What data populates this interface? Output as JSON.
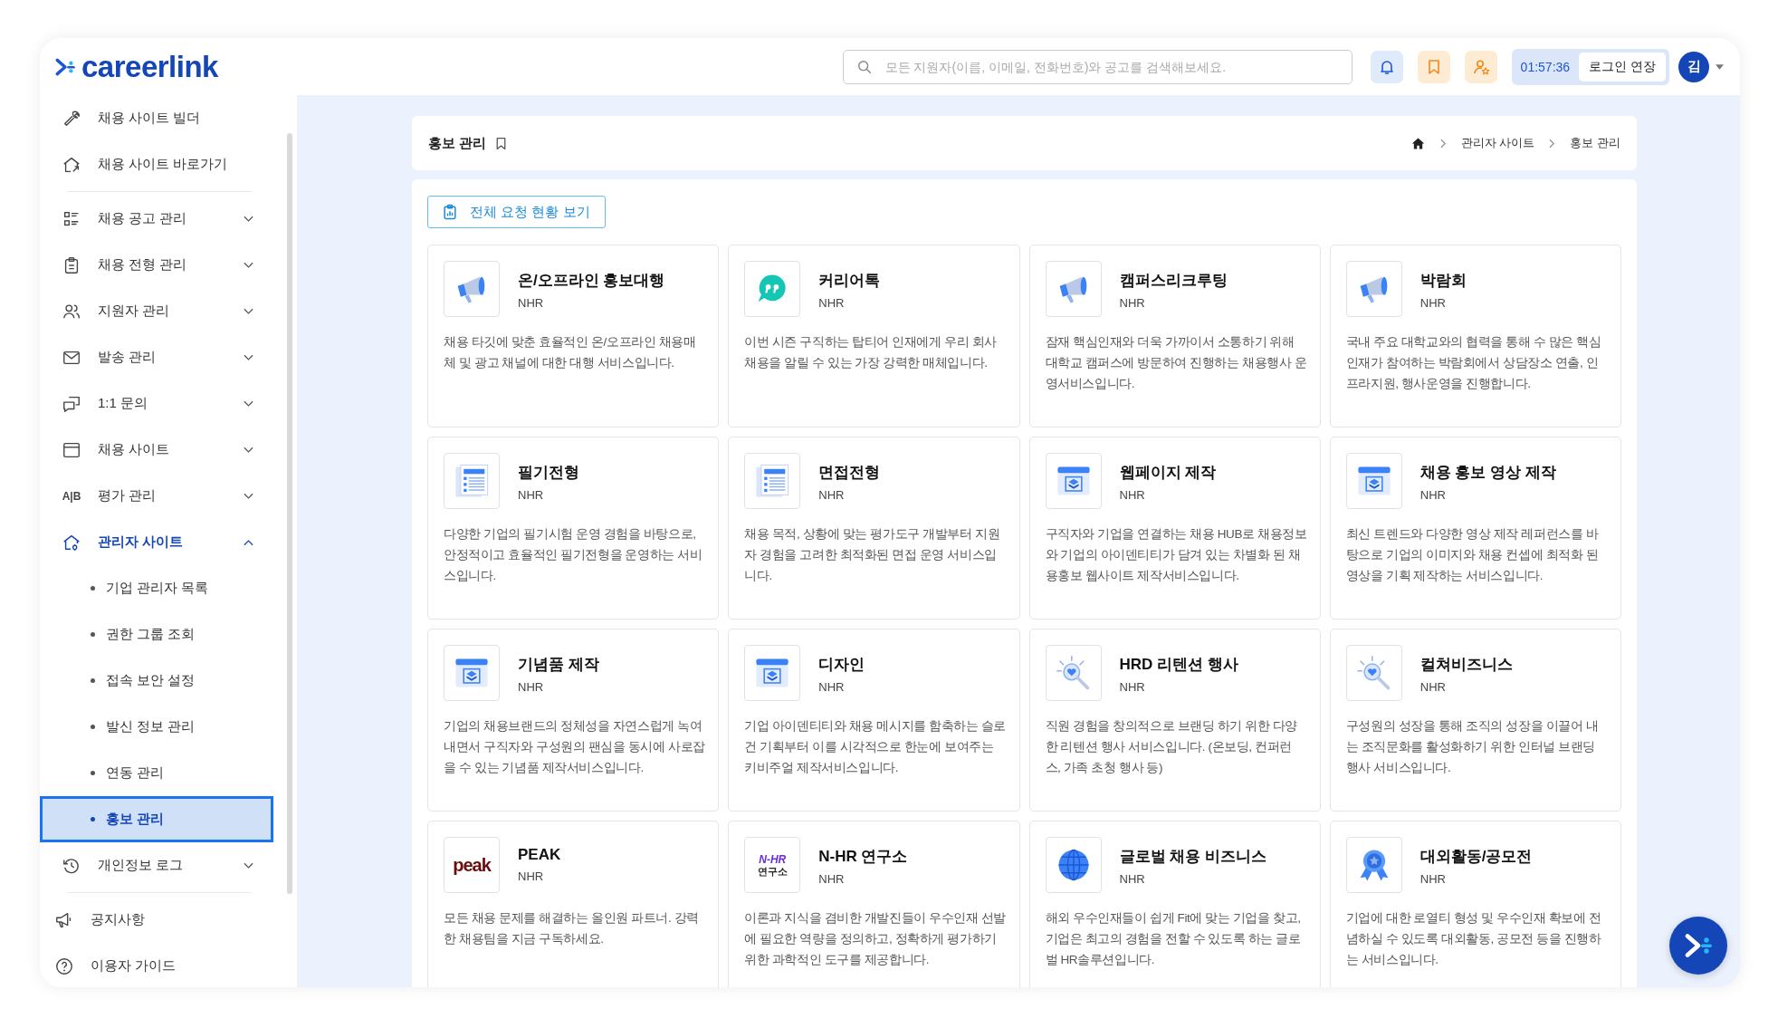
{
  "header": {
    "logo": "careerlink",
    "search": {
      "placeholder": "모든 지원자(이름, 이메일, 전화번호)와 공고를 검색해보세요."
    },
    "timer": "01:57:36",
    "extend_button": "로그인 연장",
    "avatar": "김"
  },
  "sidebar": {
    "top_links": [
      {
        "label": "채용 사이트 빌더",
        "kind": "wrench"
      },
      {
        "label": "채용 사이트 바로가기",
        "kind": "home"
      }
    ],
    "menu": [
      {
        "label": "채용 공고 관리",
        "kind": "list",
        "expanded": false
      },
      {
        "label": "채용 전형 관리",
        "kind": "clipboard",
        "expanded": false
      },
      {
        "label": "지원자 관리",
        "kind": "users",
        "expanded": false
      },
      {
        "label": "발송 관리",
        "kind": "mail",
        "expanded": false
      },
      {
        "label": "1:1 문의",
        "kind": "chat",
        "expanded": false
      },
      {
        "label": "채용 사이트",
        "kind": "window",
        "expanded": false
      },
      {
        "label": "평가 관리",
        "kind": "text",
        "icon_text": "A|B",
        "expanded": false
      },
      {
        "label": "관리자 사이트",
        "kind": "home",
        "expanded": true,
        "children": [
          {
            "label": "기업 관리자 목록",
            "selected": false
          },
          {
            "label": "권한 그룹 조회",
            "selected": false
          },
          {
            "label": "접속 보안 설정",
            "selected": false
          },
          {
            "label": "발신 정보 관리",
            "selected": false
          },
          {
            "label": "연동 관리",
            "selected": false
          },
          {
            "label": "홍보 관리",
            "selected": true
          }
        ]
      },
      {
        "label": "개인정보 로그",
        "kind": "history",
        "expanded": false
      }
    ],
    "bottom_links": [
      {
        "label": "공지사항",
        "kind": "megaphone"
      },
      {
        "label": "이용자 가이드",
        "kind": "help"
      }
    ]
  },
  "page": {
    "title": "홍보 관리",
    "breadcrumb": [
      "관리자 사이트",
      "홍보 관리"
    ],
    "view_all_button": "전체 요청 현황 보기",
    "services": [
      {
        "title": "온/오프라인 홍보대행",
        "provider": "NHR",
        "kind": "megaphone",
        "description": "채용 타깃에 맞춘 효율적인 온/오프라인 채용매체 및 광고 채널에 대한 대행 서비스입니다."
      },
      {
        "title": "커리어톡",
        "provider": "NHR",
        "kind": "chat",
        "description": "이번 시즌 구직하는 탑티어 인재에게 우리 회사 채용을 알릴 수 있는 가장 강력한 매체입니다."
      },
      {
        "title": "캠퍼스리크루팅",
        "provider": "NHR",
        "kind": "megaphone",
        "description": "잠재 핵심인재와 더욱 가까이서 소통하기 위해 대학교 캠퍼스에 방문하여 진행하는 채용행사 운영서비스입니다."
      },
      {
        "title": "박람회",
        "provider": "NHR",
        "kind": "megaphone",
        "description": "국내 주요 대학교와의 협력을 통해 수 많은 핵심인재가 참여하는 박람회에서 상담장소 연출, 인프라지원, 행사운영을 진행합니다."
      },
      {
        "title": "필기전형",
        "provider": "NHR",
        "kind": "document",
        "description": "다양한 기업의 필기시험 운영 경험을 바탕으로, 안정적이고 효율적인 필기전형을 운영하는 서비스입니다."
      },
      {
        "title": "면접전형",
        "provider": "NHR",
        "kind": "document",
        "description": "채용 목적, 상황에 맞는 평가도구 개발부터 지원자 경험을 고려한 최적화된 면접 운영 서비스입니다."
      },
      {
        "title": "웹페이지 제작",
        "provider": "NHR",
        "kind": "window",
        "description": "구직자와 기업을 연결하는 채용 HUB로 채용정보와 기업의 아이덴티티가 담겨 있는 차별화 된 채용홍보 웹사이트 제작서비스입니다."
      },
      {
        "title": "채용 홍보 영상 제작",
        "provider": "NHR",
        "kind": "window",
        "description": "최신 트렌드와 다양한 영상 제작 레퍼런스를 바탕으로 기업의 이미지와 채용 컨셉에 최적화 된 영상을 기획 제작하는 서비스입니다."
      },
      {
        "title": "기념품 제작",
        "provider": "NHR",
        "kind": "window",
        "description": "기업의 채용브랜드의 정체성을 자연스럽게 녹여내면서 구직자와 구성원의 팬심을 동시에 사로잡을 수 있는 기념품 제작서비스입니다."
      },
      {
        "title": "디자인",
        "provider": "NHR",
        "kind": "window",
        "description": "기업 아이덴티티와 채용 메시지를 함축하는 슬로건 기획부터 이를 시각적으로 한눈에 보여주는 키비주얼 제작서비스입니다."
      },
      {
        "title": "HRD 리텐션 행사",
        "provider": "NHR",
        "kind": "magnifier",
        "description": "직원 경험을 창의적으로 브랜딩 하기 위한 다양한 리텐션 행사 서비스입니다. (온보딩, 컨퍼런스, 가족 초청 행사 등)"
      },
      {
        "title": "컬쳐비즈니스",
        "provider": "NHR",
        "kind": "magnifier",
        "description": "구성원의 성장을 통해 조직의 성장을 이끌어 내는 조직문화를 활성화하기 위한 인터널 브랜딩 행사 서비스입니다."
      },
      {
        "title": "PEAK",
        "provider": "NHR",
        "kind": "wordmark",
        "logo_lines": [
          "peak"
        ],
        "description": "모든 채용 문제를 해결하는 올인원 파트너. 강력한 채용팀을 지금 구독하세요."
      },
      {
        "title": "N-HR 연구소",
        "provider": "NHR",
        "kind": "wordmark",
        "logo_lines": [
          "N-HR",
          "연구소"
        ],
        "description": "이론과 지식을 겸비한 개발진들이 우수인재 선발에 필요한 역량을 정의하고, 정확하게 평가하기 위한 과학적인 도구를 제공합니다."
      },
      {
        "title": "글로벌 채용 비즈니스",
        "provider": "NHR",
        "kind": "globe",
        "description": "해외 우수인재들이 쉽게 Fit에 맞는 기업을 찾고, 기업은 최고의 경험을 전할 수 있도록 하는 글로벌 HR솔루션입니다."
      },
      {
        "title": "대외활동/공모전",
        "provider": "NHR",
        "kind": "medal",
        "description": "기업에 대한 로열티 형성 및 우수인재 확보에 전념하실 수 있도록 대외활동, 공모전 등을 진행하는 서비스입니다."
      }
    ]
  }
}
